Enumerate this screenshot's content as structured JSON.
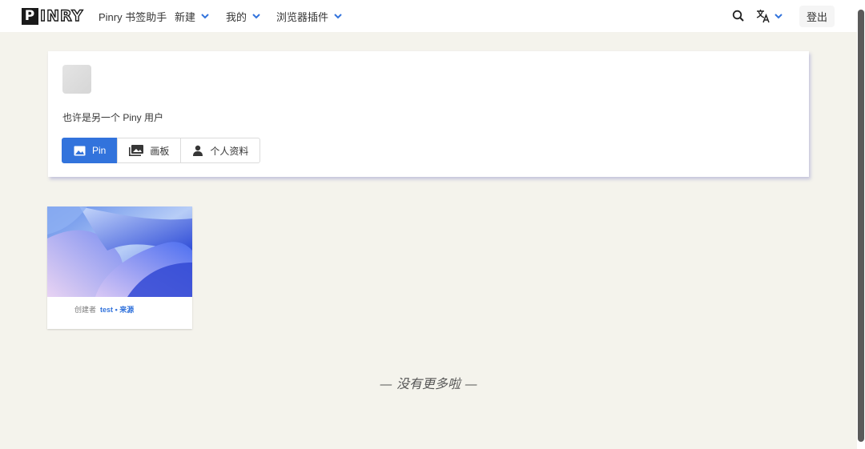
{
  "navbar": {
    "logo_first": "P",
    "logo_rest": "INRY",
    "items": [
      {
        "label": "Pinry 书签助手",
        "has_dropdown": false
      },
      {
        "label": "新建",
        "has_dropdown": true
      },
      {
        "label": "我的",
        "has_dropdown": true
      },
      {
        "label": "浏览器插件",
        "has_dropdown": true
      }
    ],
    "search_icon": "search-icon",
    "language_icon": "translate-icon",
    "logout_label": "登出"
  },
  "profile": {
    "username_text": "也许是另一个 Piny 用户",
    "tabs": [
      {
        "label": "Pin",
        "icon": "image-icon",
        "active": true
      },
      {
        "label": "画板",
        "icon": "images-icon",
        "active": false
      },
      {
        "label": "个人资料",
        "icon": "user-icon",
        "active": false
      }
    ]
  },
  "pins": [
    {
      "creator_prefix": "创建者",
      "creator": "test",
      "separator": "•",
      "source_label": "来源"
    }
  ],
  "footer": {
    "no_more_text": "— 没有更多啦 —"
  },
  "colors": {
    "accent": "#3273dc",
    "background": "#f4f3ec"
  }
}
